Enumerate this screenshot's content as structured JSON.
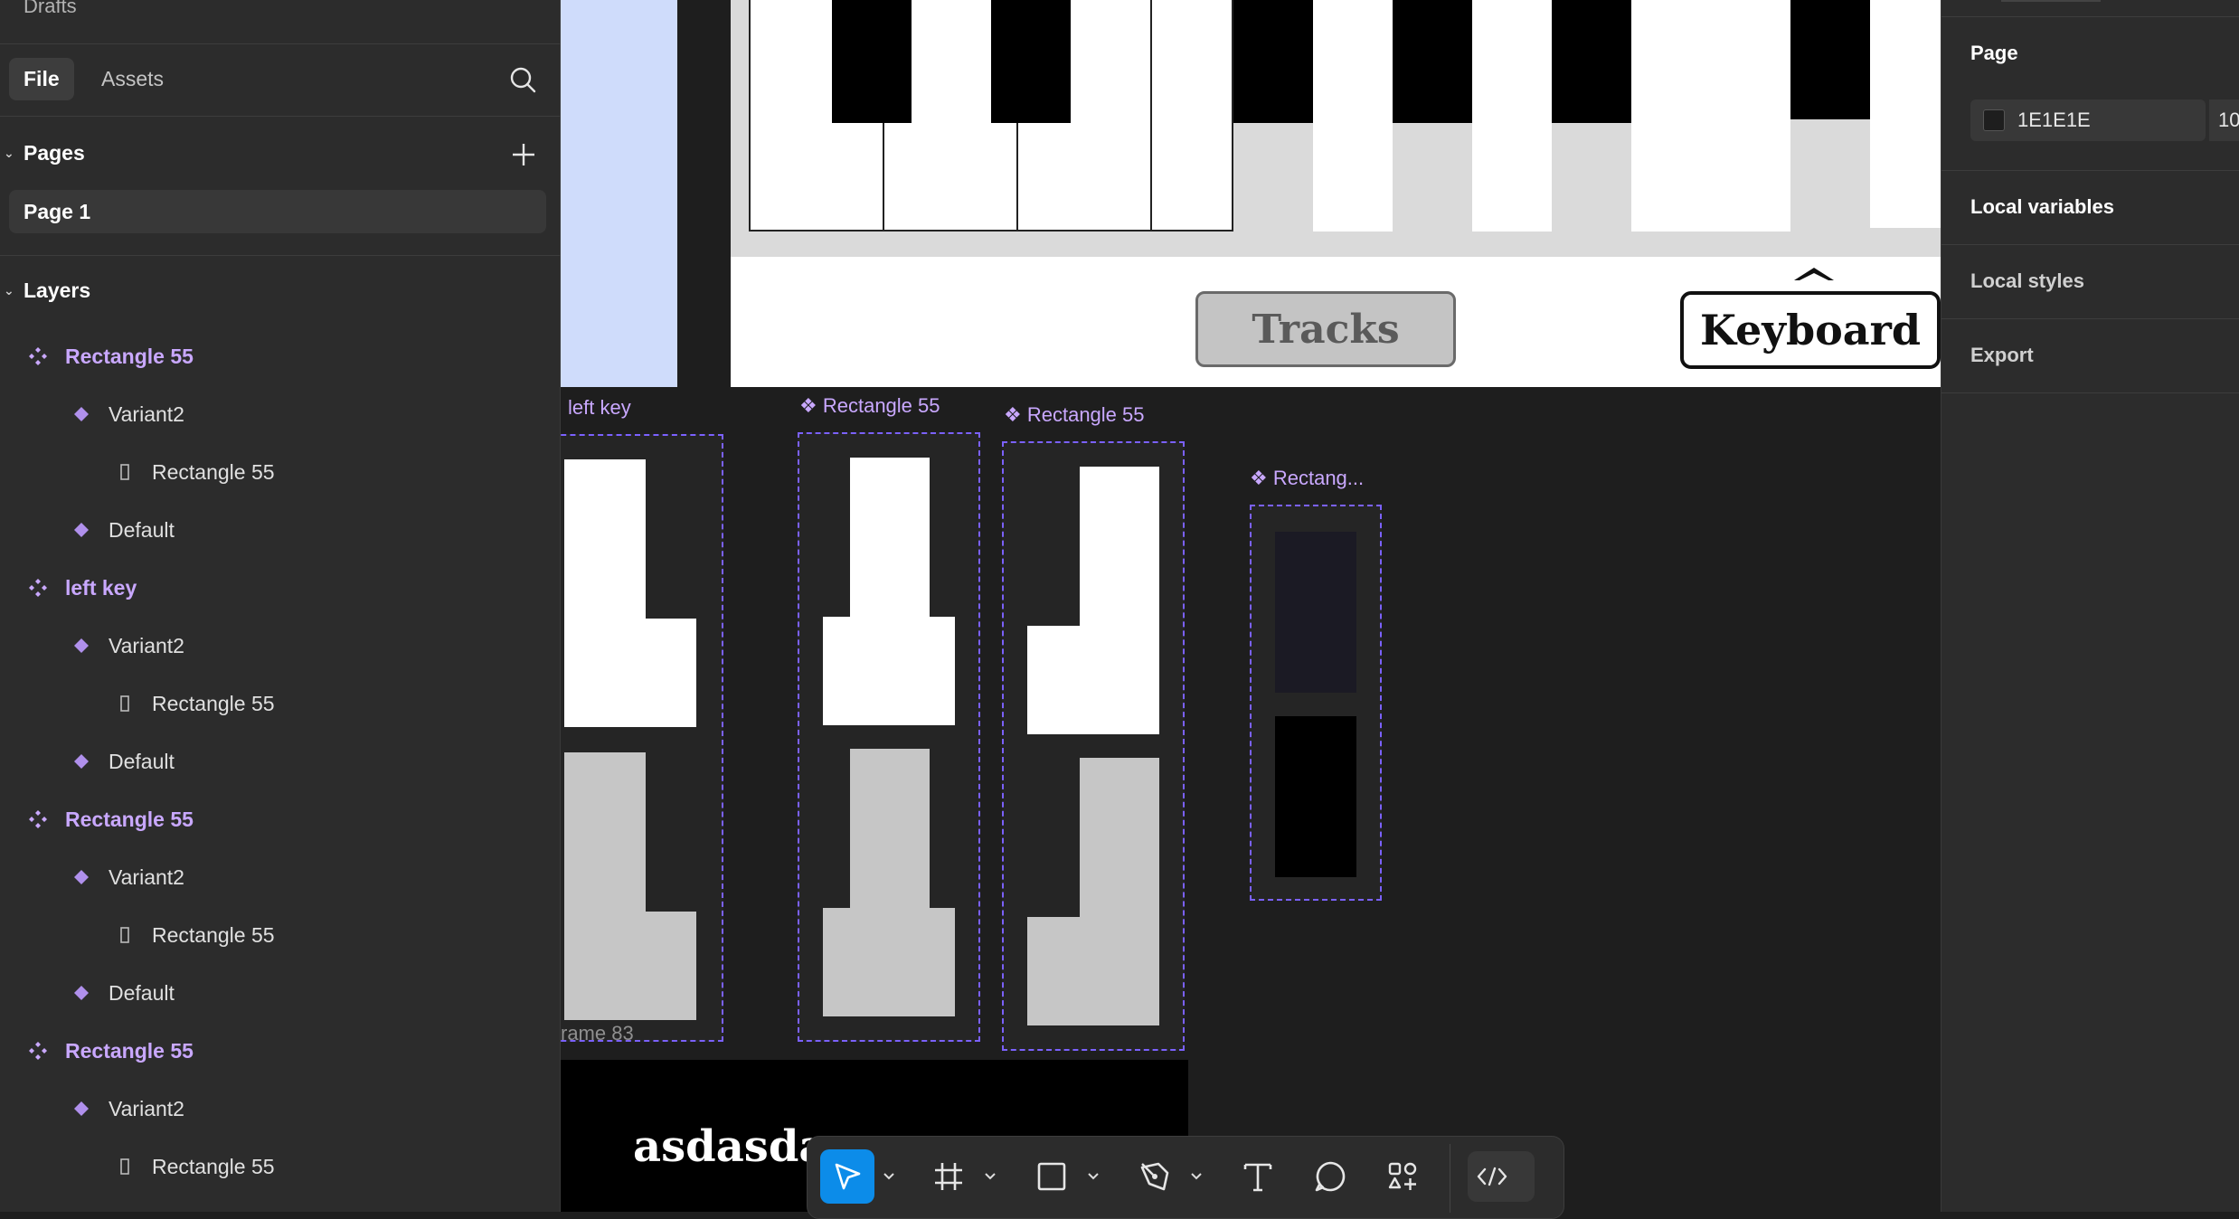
{
  "left_panel": {
    "title": "Drafts",
    "tabs": [
      {
        "label": "File"
      },
      {
        "label": "Assets"
      }
    ],
    "pages_heading": "Pages",
    "pages": [
      "Page 1"
    ],
    "layers_heading": "Layers",
    "layers": [
      {
        "label": "Rectangle 55",
        "kind": "component-set"
      },
      {
        "label": "Variant2",
        "kind": "variant"
      },
      {
        "label": "Rectangle 55",
        "kind": "rectangle"
      },
      {
        "label": "Default",
        "kind": "variant"
      },
      {
        "label": "left key",
        "kind": "component-set"
      },
      {
        "label": "Variant2",
        "kind": "variant"
      },
      {
        "label": "Rectangle 55",
        "kind": "rectangle"
      },
      {
        "label": "Default",
        "kind": "variant"
      },
      {
        "label": "Rectangle 55",
        "kind": "component-set"
      },
      {
        "label": "Variant2",
        "kind": "variant"
      },
      {
        "label": "Rectangle 55",
        "kind": "rectangle"
      },
      {
        "label": "Default",
        "kind": "variant"
      },
      {
        "label": "Rectangle 55",
        "kind": "component-set"
      },
      {
        "label": "Variant2",
        "kind": "variant"
      },
      {
        "label": "Rectangle 55",
        "kind": "rectangle"
      }
    ]
  },
  "canvas": {
    "buttons": {
      "tracks": "Tracks",
      "keyboard": "Keyboard"
    },
    "frame_labels": {
      "left_key": "left key",
      "rect1": "Rectangle 55",
      "rect2": "Rectangle 55",
      "rect3": "Rectang...",
      "frame83": "rame 83"
    },
    "bottom_text": "asdasda"
  },
  "right_panel": {
    "page_heading": "Page",
    "bg_color": "1E1E1E",
    "bg_opacity": "10",
    "local_variables": "Local variables",
    "local_styles": "Local styles",
    "export": "Export"
  },
  "toolbar": {
    "tools": [
      "move-tool",
      "frame-tool",
      "shape-tool",
      "pen-tool",
      "text-tool",
      "comment-tool",
      "actions-tool",
      "dev-mode-toggle"
    ],
    "active_tool": "move-tool"
  },
  "colors": {
    "canvas_bg": "#1e1e1e",
    "panel_bg": "#2c2c2c",
    "component_purple": "#c9a8ff",
    "selection_blue": "#0c8ce9",
    "dashed_border": "#7b61ff"
  }
}
